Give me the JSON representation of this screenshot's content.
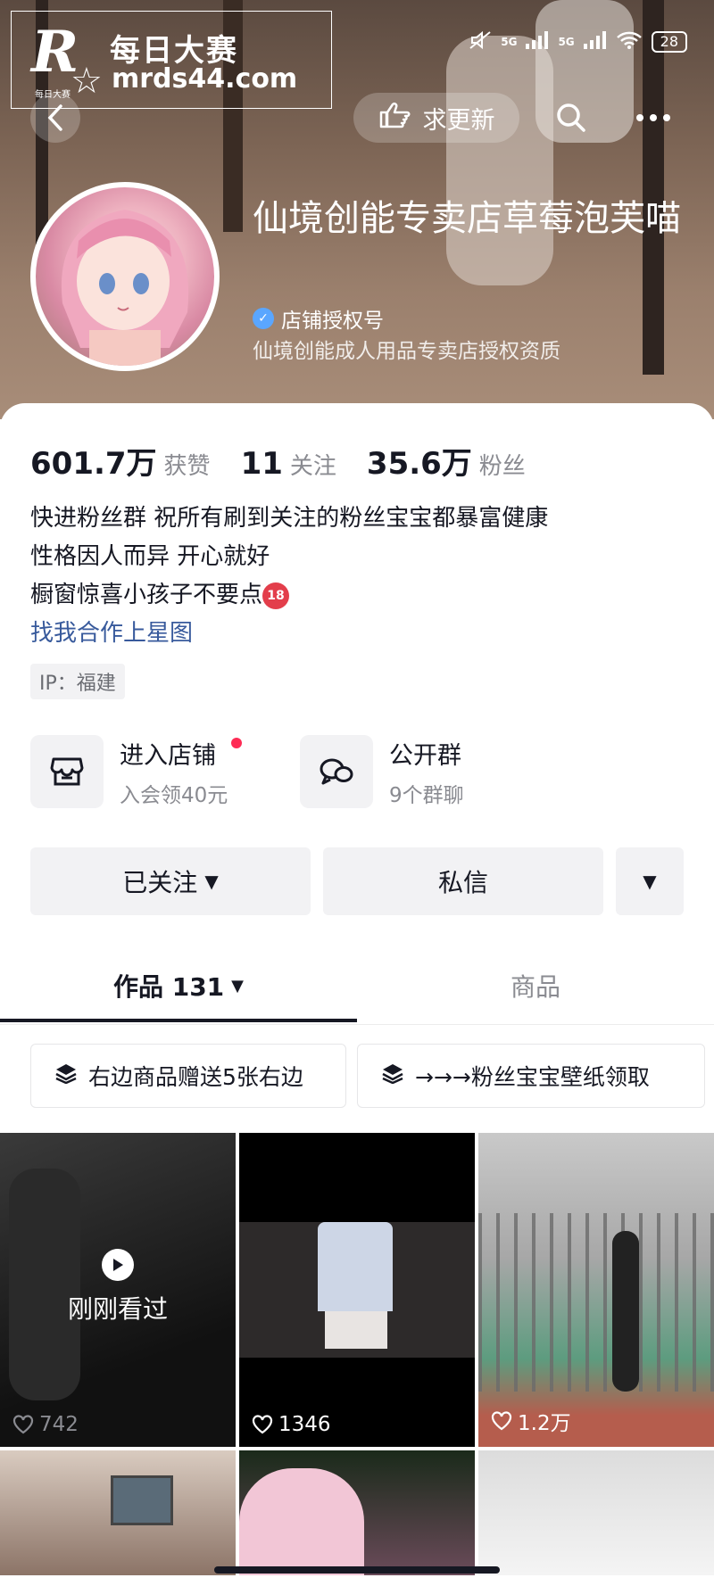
{
  "watermark": {
    "logo": "R",
    "logo_small": "每日大赛",
    "title": "每日大赛",
    "url": "mrds44.com"
  },
  "status_bar": {
    "network1": "5G",
    "network2": "5G",
    "battery": "28"
  },
  "header": {
    "update_label": "求更新"
  },
  "profile": {
    "name": "仙境创能专卖店草莓泡芙喵",
    "verified_label": "店铺授权号",
    "verified_desc": "仙境创能成人用品专卖店授权资质",
    "stats": [
      {
        "num": "601.7万",
        "label": "获赞"
      },
      {
        "num": "11",
        "label": "关注"
      },
      {
        "num": "35.6万",
        "label": "粉丝"
      }
    ],
    "bio_lines": [
      "快进粉丝群 祝所有刷到关注的粉丝宝宝都暴富健康",
      "性格因人而异 开心就好",
      "橱窗惊喜小孩子不要点"
    ],
    "bio_badge": "18",
    "bio_link": "找我合作上星图",
    "ip": "IP：福建"
  },
  "quick_actions": [
    {
      "title": "进入店铺",
      "sub": "入会领40元",
      "icon": "store-icon"
    },
    {
      "title": "公开群",
      "sub": "9个群聊",
      "icon": "group-chat-icon"
    }
  ],
  "buttons": {
    "followed": "已关注",
    "message": "私信"
  },
  "tabs": {
    "works": "作品 131",
    "products": "商品"
  },
  "collections": [
    "右边商品赠送5张右边",
    "→→→粉丝宝宝壁纸领取"
  ],
  "grid": {
    "recent_label": "刚刚看过",
    "likes": [
      "742",
      "1346",
      "1.2万"
    ]
  }
}
